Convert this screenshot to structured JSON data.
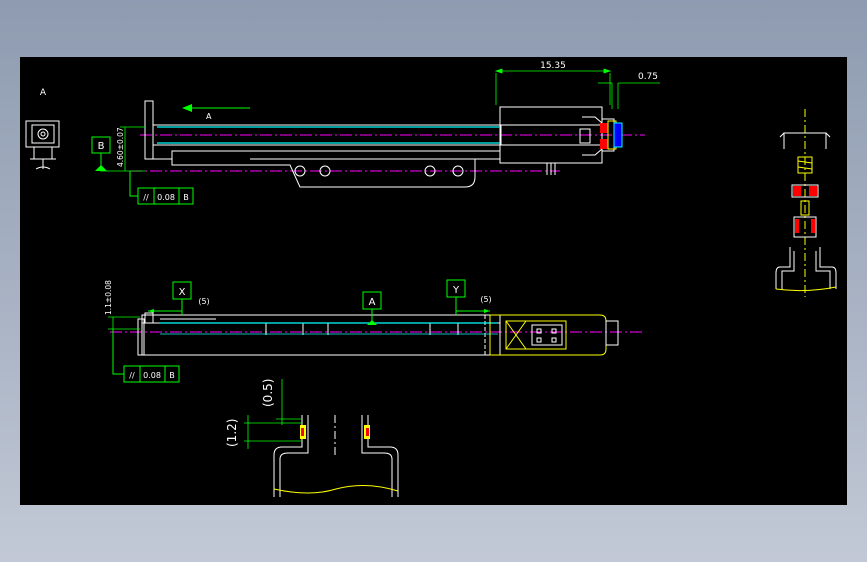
{
  "colors": {
    "background": "#000000",
    "outline": "#ffffff",
    "dimension": "#00ff00",
    "centerline": "#ff00ff",
    "highlight": "#00ffff",
    "part": "#ffff00",
    "accent_red": "#ff0000",
    "accent_blue": "#0000ff"
  },
  "top_view": {
    "dim_length": "15.35",
    "dim_offset": "0.75",
    "dim_height": "4.60±0.07",
    "arrow_label": "A",
    "datum_label": "B",
    "tolerance": {
      "symbol": "//",
      "value": "0.08",
      "datum": "B"
    }
  },
  "end_view": {
    "label": "A"
  },
  "side_view": {
    "dim_height": "1.1±0.08",
    "datum_x": "X",
    "datum_y": "Y",
    "datum_a": "A",
    "dim_x_offset": "(5)",
    "dim_y_offset": "(5)",
    "tolerance": {
      "symbol": "//",
      "value": "0.08",
      "datum": "B"
    }
  },
  "detail_view": {
    "dim_upper": "(0.5)",
    "dim_lower": "(1.2)"
  }
}
